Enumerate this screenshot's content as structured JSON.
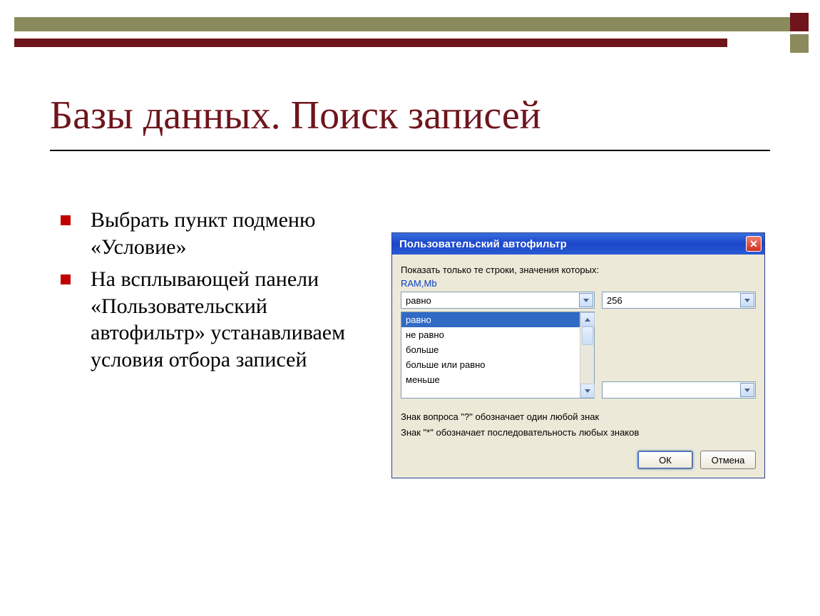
{
  "slide": {
    "title": "Базы данных. Поиск записей",
    "bullets": [
      "Выбрать пункт подменю «Условие»",
      "На всплывающей панели «Пользовательский автофильтр» устанавливаем условия отбора записей"
    ]
  },
  "dialog": {
    "title": "Пользовательский автофильтр",
    "instruction": "Показать только те строки, значения которых:",
    "field_label": "RAM,Mb",
    "condition1_op": "равно",
    "condition1_val": "256",
    "dropdown_options": [
      "равно",
      "не равно",
      "больше",
      "больше или равно",
      "меньше"
    ],
    "condition2_op": "",
    "condition2_val": "",
    "note1": "Знак вопроса \"?\" обозначает один любой знак",
    "note2": "Знак \"*\" обозначает последовательность любых знаков",
    "ok_label": "ОК",
    "cancel_label": "Отмена"
  }
}
